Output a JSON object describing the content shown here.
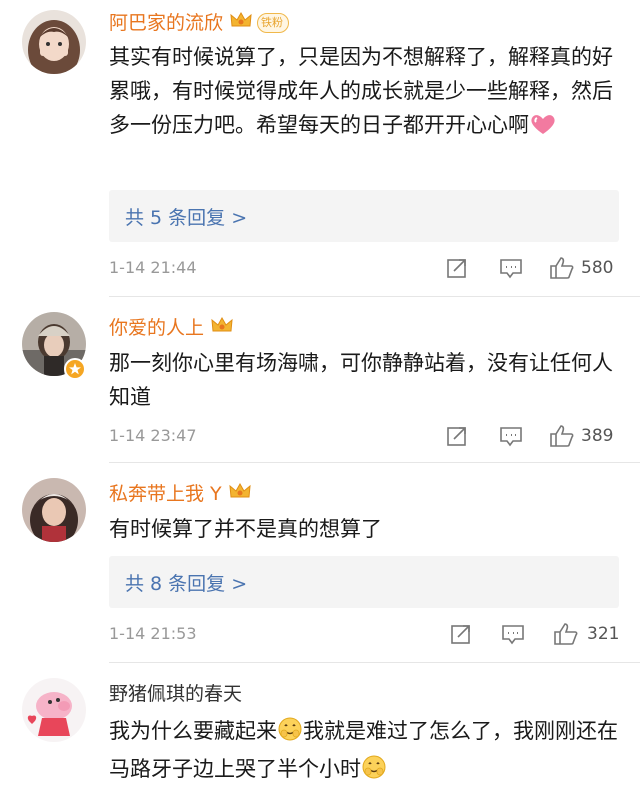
{
  "comments": [
    {
      "username": "阿巴家的流欣",
      "fan_badge": "铁粉",
      "text": "其实有时候说算了，只是因为不想解释了，解释真的好累哦，有时候觉得成年人的成长就是少一些解释，然后多一份压力吧。希望每天的日子都开开心心啊",
      "reply_link": "共 5 条回复 >",
      "time": "1-14 21:44",
      "likes": "580"
    },
    {
      "username": "你爱的人上",
      "text": "那一刻你心里有场海啸，可你静静站着，没有让任何人知道",
      "time": "1-14 23:47",
      "likes": "389"
    },
    {
      "username": "私奔带上我 Y",
      "text": "有时候算了并不是真的想算了",
      "reply_link": "共 8 条回复 >",
      "time": "1-14 21:53",
      "likes": "321"
    },
    {
      "username": "野猪佩琪的春天",
      "text_part1": "我为什么要藏起来",
      "text_part2": "我就是难过了怎么了，我刚刚还在马路牙子边上哭了半个小时"
    }
  ],
  "colors": {
    "username_vip": "#e8761f",
    "reply_link": "#4a74b0",
    "meta_gray": "#999999"
  },
  "icons": [
    "repost-icon",
    "comment-icon",
    "like-icon",
    "crown-icon",
    "heart-emoji",
    "smile-emoji"
  ]
}
